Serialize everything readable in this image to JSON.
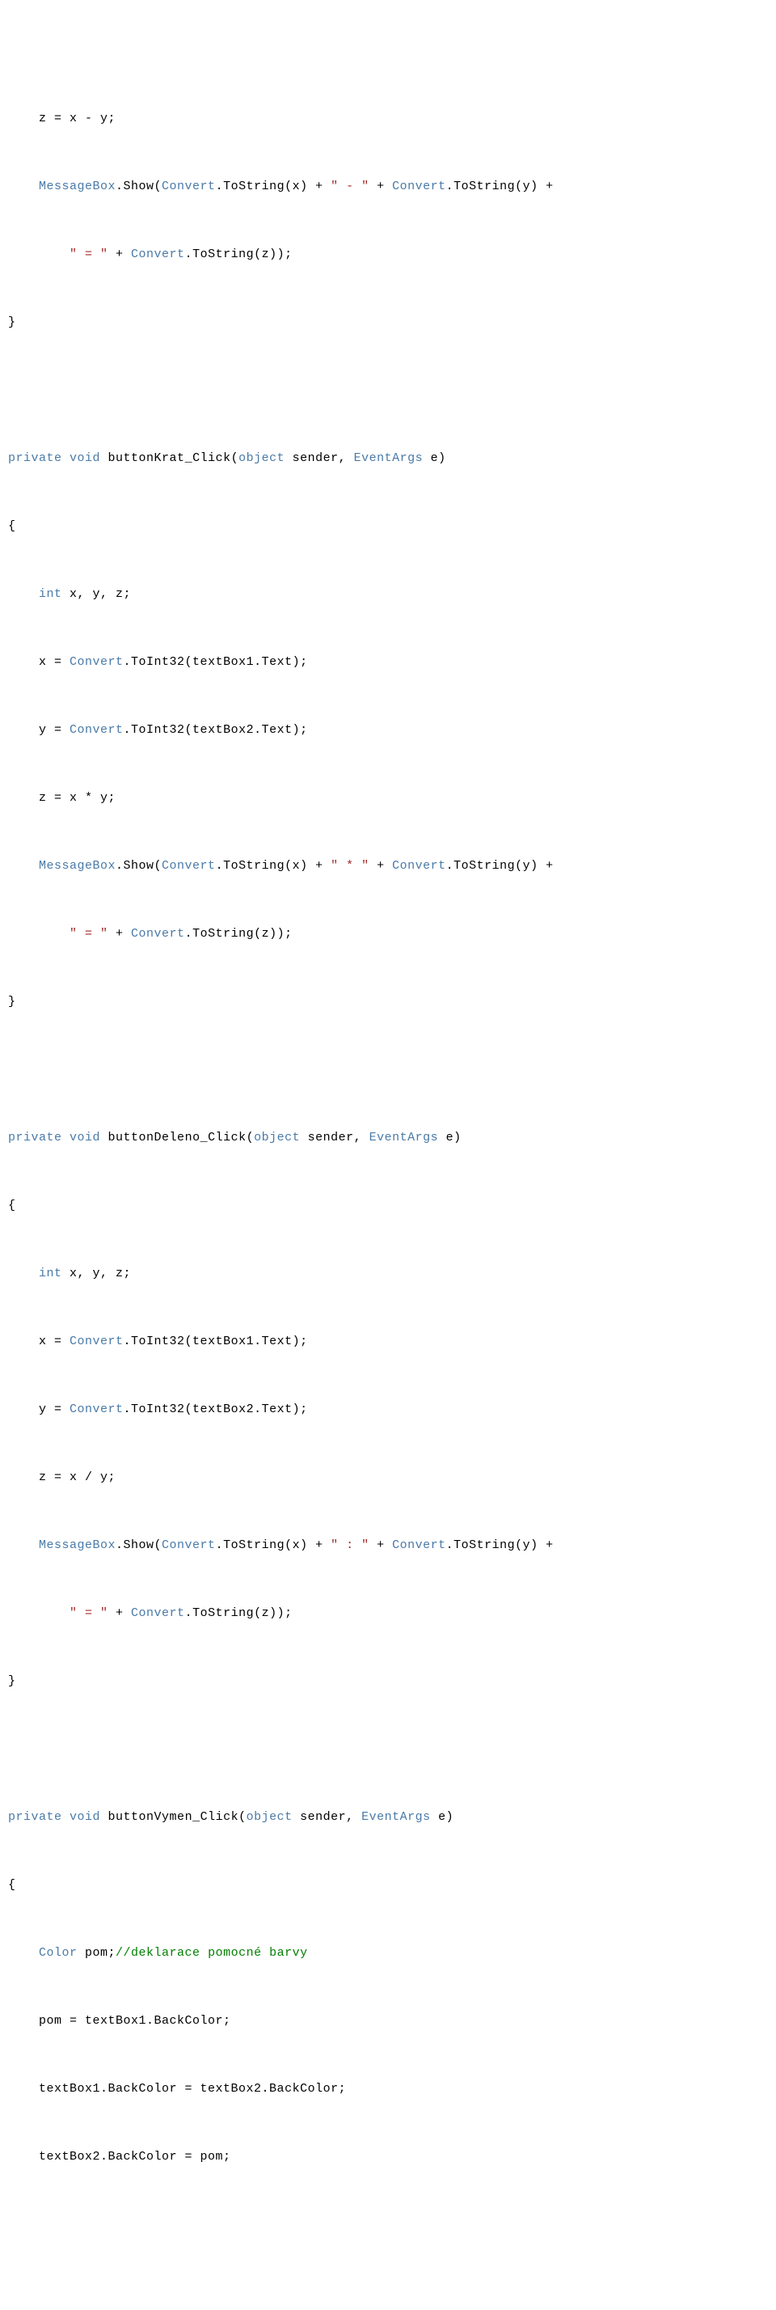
{
  "code_lines": [
    [
      [
        "    "
      ],
      [
        "z = x - y;"
      ]
    ],
    [],
    [
      [
        "    "
      ],
      [
        "MessageBox",
        "ty"
      ],
      [
        ".Show("
      ],
      [
        "Convert",
        "ty"
      ],
      [
        ".ToString(x) + "
      ],
      [
        "\" - \"",
        "str"
      ],
      [
        " + "
      ],
      [
        "Convert",
        "ty"
      ],
      [
        ".ToString(y) +"
      ]
    ],
    [],
    [
      [
        "        "
      ],
      [
        "\" = \"",
        "str"
      ],
      [
        " + "
      ],
      [
        "Convert",
        "ty"
      ],
      [
        ".ToString(z));"
      ]
    ],
    [],
    [
      [
        "}"
      ]
    ],
    [],
    [],
    [],
    [
      [
        "private",
        "kw"
      ],
      [
        " "
      ],
      [
        "void",
        "kw"
      ],
      [
        " buttonKrat_Click("
      ],
      [
        "object",
        "kw"
      ],
      [
        " sender, "
      ],
      [
        "EventArgs",
        "ty"
      ],
      [
        " e)"
      ]
    ],
    [],
    [
      [
        "{"
      ]
    ],
    [],
    [
      [
        "    "
      ],
      [
        "int",
        "kw"
      ],
      [
        " x, y, z;"
      ]
    ],
    [],
    [
      [
        "    "
      ],
      [
        "x = "
      ],
      [
        "Convert",
        "ty"
      ],
      [
        ".ToInt32(textBox1.Text);"
      ]
    ],
    [],
    [
      [
        "    "
      ],
      [
        "y = "
      ],
      [
        "Convert",
        "ty"
      ],
      [
        ".ToInt32(textBox2.Text);"
      ]
    ],
    [],
    [
      [
        "    "
      ],
      [
        "z = x * y;"
      ]
    ],
    [],
    [
      [
        "    "
      ],
      [
        "MessageBox",
        "ty"
      ],
      [
        ".Show("
      ],
      [
        "Convert",
        "ty"
      ],
      [
        ".ToString(x) + "
      ],
      [
        "\" * \"",
        "str"
      ],
      [
        " + "
      ],
      [
        "Convert",
        "ty"
      ],
      [
        ".ToString(y) +"
      ]
    ],
    [],
    [
      [
        "        "
      ],
      [
        "\" = \"",
        "str"
      ],
      [
        " + "
      ],
      [
        "Convert",
        "ty"
      ],
      [
        ".ToString(z));"
      ]
    ],
    [],
    [
      [
        "}"
      ]
    ],
    [],
    [],
    [],
    [
      [
        "private",
        "kw"
      ],
      [
        " "
      ],
      [
        "void",
        "kw"
      ],
      [
        " buttonDeleno_Click("
      ],
      [
        "object",
        "kw"
      ],
      [
        " sender, "
      ],
      [
        "EventArgs",
        "ty"
      ],
      [
        " e)"
      ]
    ],
    [],
    [
      [
        "{"
      ]
    ],
    [],
    [
      [
        "    "
      ],
      [
        "int",
        "kw"
      ],
      [
        " x, y, z;"
      ]
    ],
    [],
    [
      [
        "    "
      ],
      [
        "x = "
      ],
      [
        "Convert",
        "ty"
      ],
      [
        ".ToInt32(textBox1.Text);"
      ]
    ],
    [],
    [
      [
        "    "
      ],
      [
        "y = "
      ],
      [
        "Convert",
        "ty"
      ],
      [
        ".ToInt32(textBox2.Text);"
      ]
    ],
    [],
    [
      [
        "    "
      ],
      [
        "z = x / y;"
      ]
    ],
    [],
    [
      [
        "    "
      ],
      [
        "MessageBox",
        "ty"
      ],
      [
        ".Show("
      ],
      [
        "Convert",
        "ty"
      ],
      [
        ".ToString(x) + "
      ],
      [
        "\" : \"",
        "str"
      ],
      [
        " + "
      ],
      [
        "Convert",
        "ty"
      ],
      [
        ".ToString(y) +"
      ]
    ],
    [],
    [
      [
        "        "
      ],
      [
        "\" = \"",
        "str"
      ],
      [
        " + "
      ],
      [
        "Convert",
        "ty"
      ],
      [
        ".ToString(z));"
      ]
    ],
    [],
    [
      [
        "}"
      ]
    ],
    [],
    [],
    [],
    [
      [
        "private",
        "kw"
      ],
      [
        " "
      ],
      [
        "void",
        "kw"
      ],
      [
        " buttonVymen_Click("
      ],
      [
        "object",
        "kw"
      ],
      [
        " sender, "
      ],
      [
        "EventArgs",
        "ty"
      ],
      [
        " e)"
      ]
    ],
    [],
    [
      [
        "{"
      ]
    ],
    [],
    [
      [
        "    "
      ],
      [
        "Color",
        "ty"
      ],
      [
        " pom;"
      ],
      [
        "//deklarace pomocné barvy",
        "com"
      ]
    ],
    [],
    [
      [
        "    "
      ],
      [
        "pom = textBox1.BackColor;"
      ]
    ],
    [],
    [
      [
        "    "
      ],
      [
        "textBox1.BackColor = textBox2.BackColor;"
      ]
    ],
    [],
    [
      [
        "    "
      ],
      [
        "textBox2.BackColor = pom;"
      ]
    ]
  ]
}
